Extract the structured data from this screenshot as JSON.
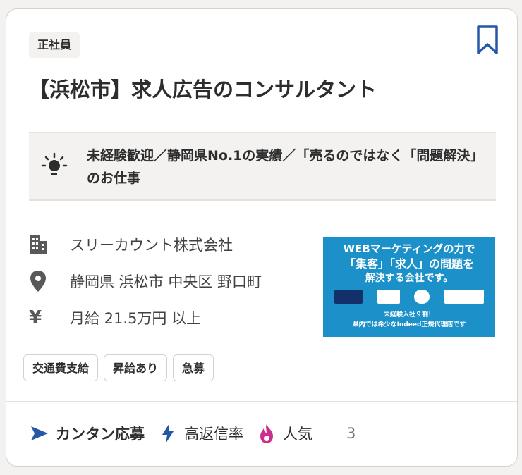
{
  "job": {
    "employment_type": "正社員",
    "title": "【浜松市】求人広告のコンサルタント",
    "highlight": "未経験歓迎／静岡県No.1の実績／「売るのではなく「問題解決」のお仕事",
    "company": "スリーカウント株式会社",
    "location": "静岡県 浜松市 中央区 野口町",
    "salary": "月給 21.5万円 以上",
    "tags": [
      "交通費支給",
      "昇給あり",
      "急募"
    ]
  },
  "ad": {
    "line1": "WEBマーケティングの力で",
    "line2": "「集客」「求人」の問題を",
    "line3": "解決する会社です。",
    "line4": "未経験入社９割！",
    "line5": "県内では希少なIndeed正規代理店です"
  },
  "footer": {
    "easy_apply": "カンタン応募",
    "high_response": "高返信率",
    "popular": "人気",
    "truncated": "3"
  },
  "icons": {
    "bookmark": "bookmark-icon",
    "lightbulb": "lightbulb-icon",
    "company": "building-icon",
    "location": "location-pin-icon",
    "salary": "yen-icon",
    "easy_apply": "send-arrow-icon",
    "high_response": "lightning-icon",
    "popular": "flame-icon"
  },
  "colors": {
    "accent_blue": "#2557a7",
    "popular_pink": "#cd2d8c",
    "ad_blue": "#1b90c9",
    "text": "#2d2d2d"
  }
}
